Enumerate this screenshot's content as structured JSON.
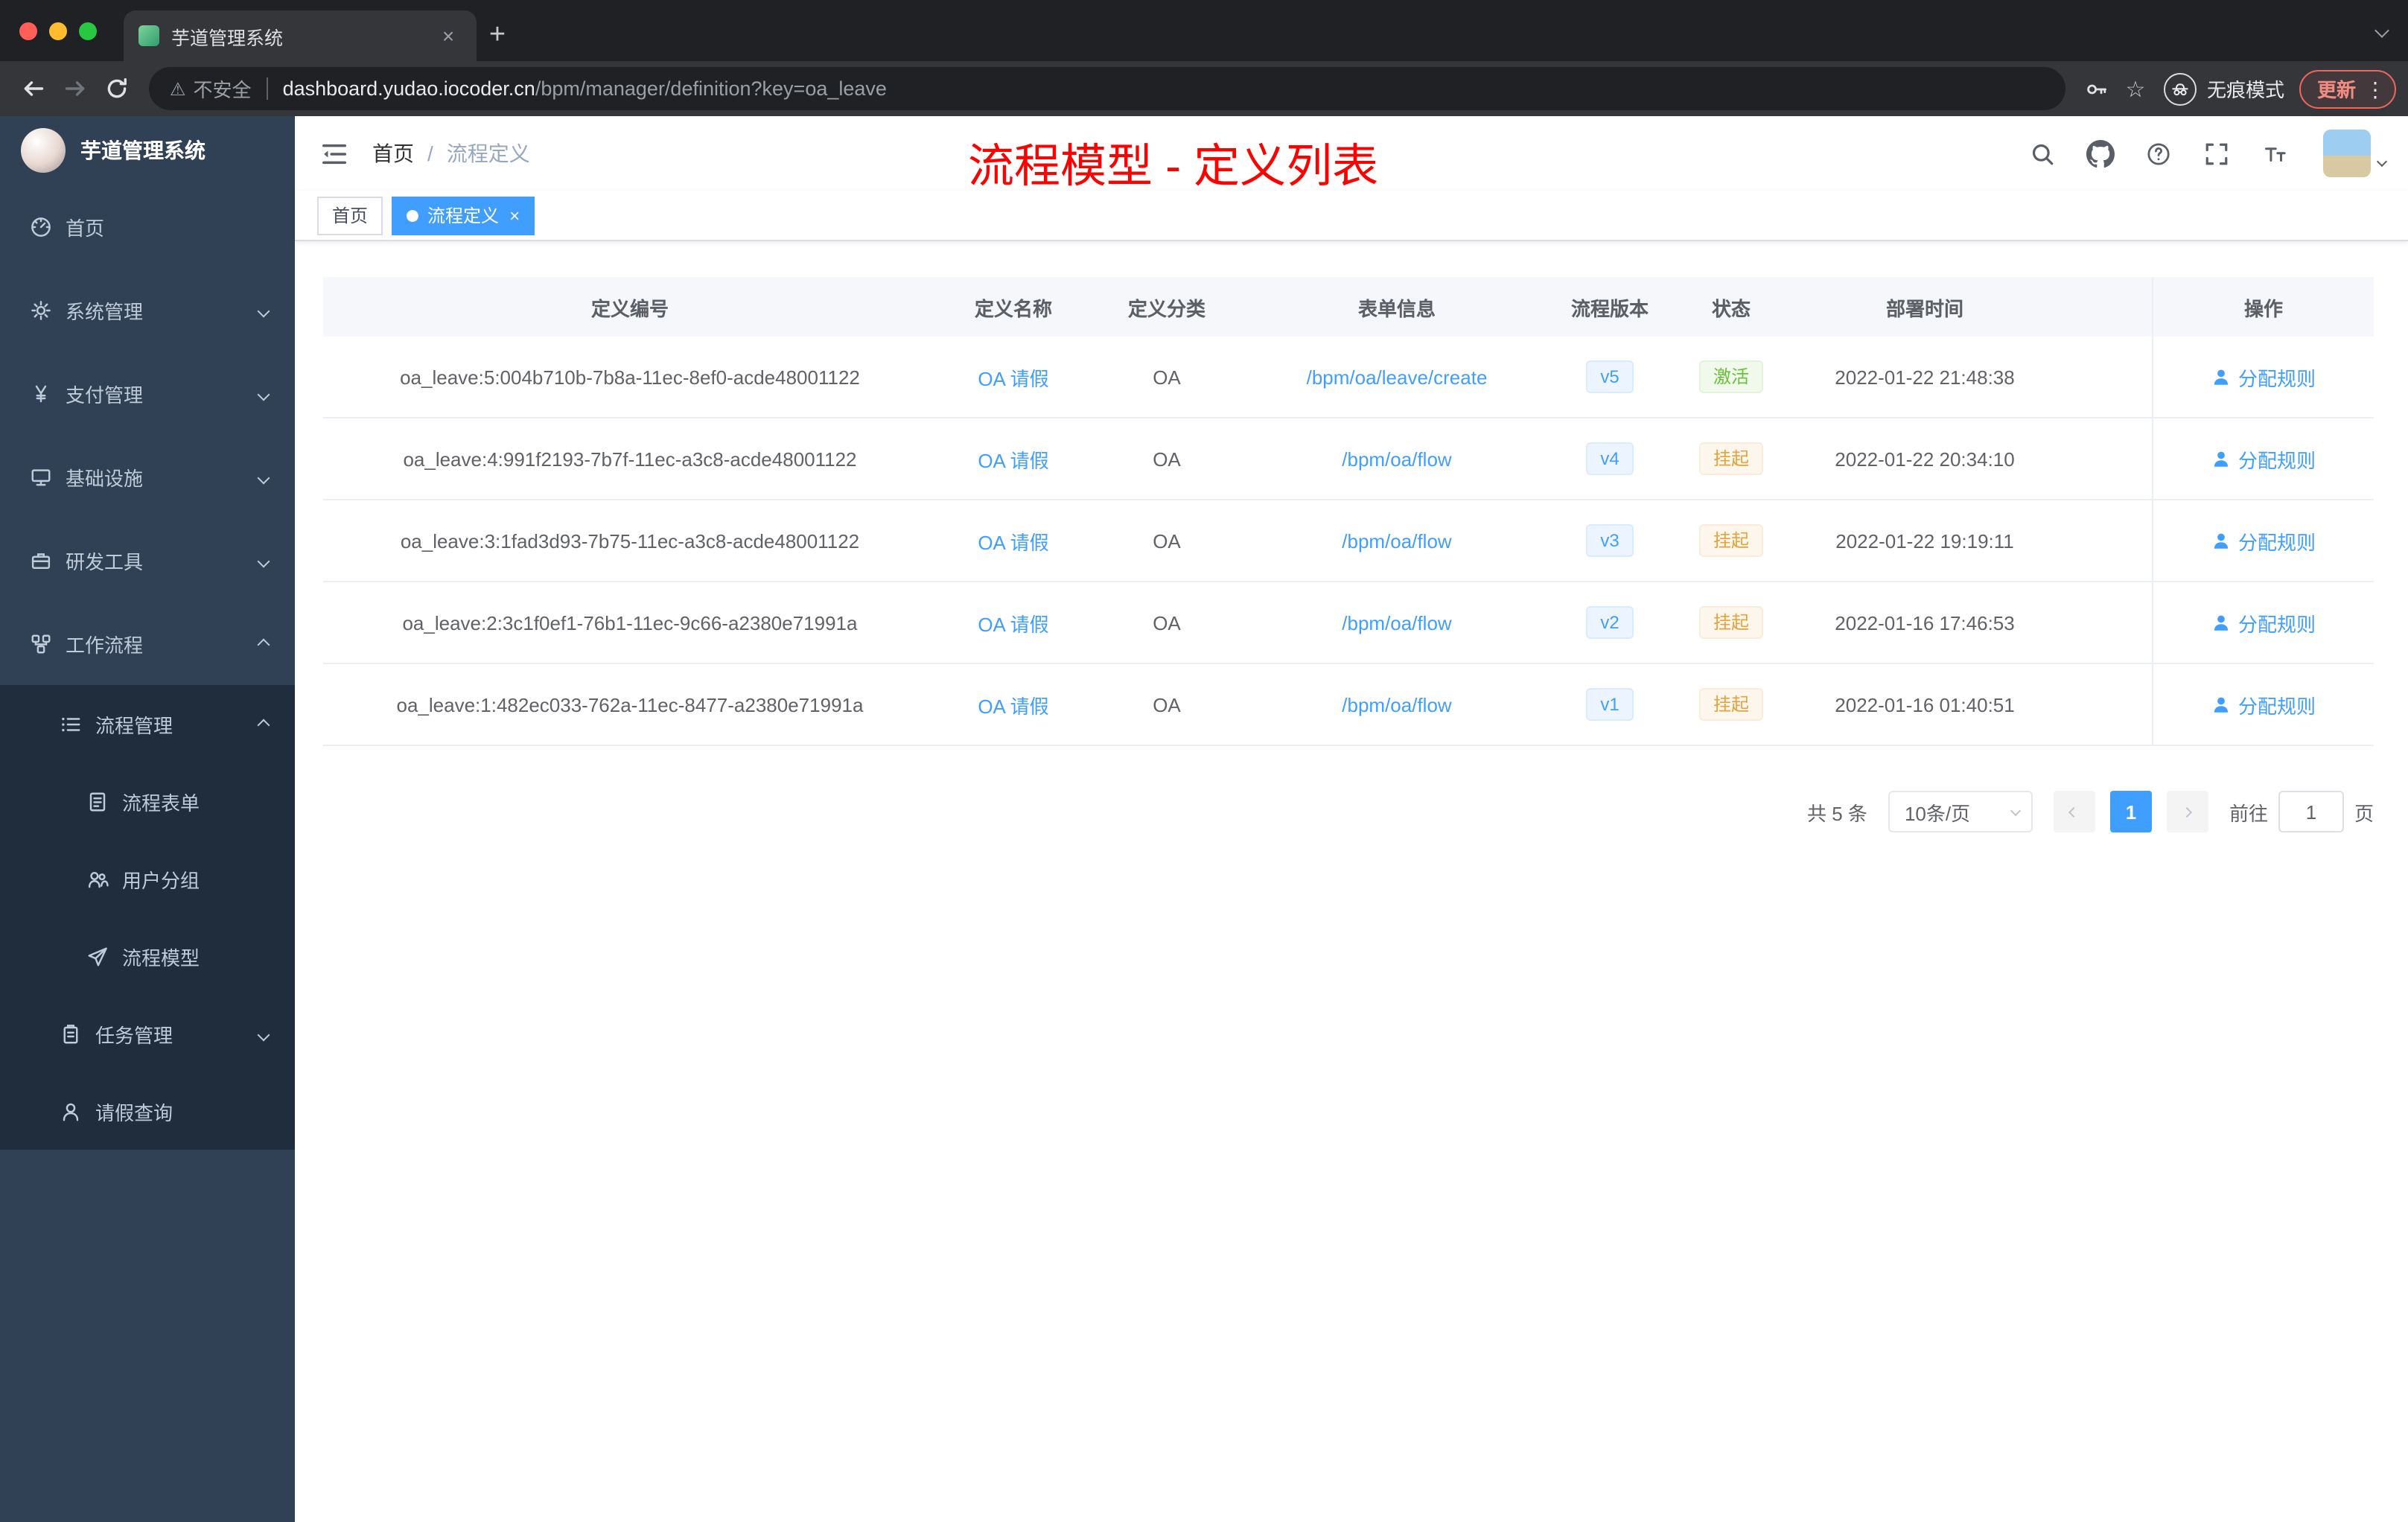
{
  "glyphs": {
    "close": "×",
    "plus": "+",
    "star": "☆",
    "warning": "⚠",
    "kebab": "⋮"
  },
  "browser": {
    "tab_title": "芋道管理系统",
    "security_label": "不安全",
    "url_host": "dashboard.yudao.iocoder.cn",
    "url_path": "/bpm/manager/definition?key=oa_leave",
    "incognito_label": "无痕模式",
    "update_label": "更新"
  },
  "sidebar": {
    "app_title": "芋道管理系统",
    "items": [
      {
        "label": "首页",
        "icon": "dashboard-icon"
      },
      {
        "label": "系统管理",
        "icon": "gear-icon"
      },
      {
        "label": "支付管理",
        "icon": "yen-icon"
      },
      {
        "label": "基础设施",
        "icon": "monitor-icon"
      },
      {
        "label": "研发工具",
        "icon": "briefcase-icon"
      },
      {
        "label": "工作流程",
        "icon": "workflow-icon"
      },
      {
        "label": "流程管理",
        "icon": "list-icon"
      },
      {
        "label": "流程表单",
        "icon": "form-icon"
      },
      {
        "label": "用户分组",
        "icon": "users-icon"
      },
      {
        "label": "流程模型",
        "icon": "send-icon"
      },
      {
        "label": "任务管理",
        "icon": "clipboard-icon"
      },
      {
        "label": "请假查询",
        "icon": "user-icon"
      }
    ]
  },
  "navbar": {
    "breadcrumb_home": "首页",
    "breadcrumb_separator": "/",
    "breadcrumb_current": "流程定义",
    "annotation": "流程模型 - 定义列表"
  },
  "tags": [
    {
      "label": "首页",
      "active": false
    },
    {
      "label": "流程定义",
      "active": true
    }
  ],
  "table": {
    "columns": [
      "定义编号",
      "定义名称",
      "定义分类",
      "表单信息",
      "流程版本",
      "状态",
      "部署时间",
      "操作"
    ],
    "rows": [
      {
        "id": "oa_leave:5:004b710b-7b8a-11ec-8ef0-acde48001122",
        "name": "OA 请假",
        "category": "OA",
        "form": "/bpm/oa/leave/create",
        "version": "v5",
        "status": "激活",
        "status_type": "success",
        "time": "2022-01-22 21:48:38",
        "action": "分配规则"
      },
      {
        "id": "oa_leave:4:991f2193-7b7f-11ec-a3c8-acde48001122",
        "name": "OA 请假",
        "category": "OA",
        "form": "/bpm/oa/flow",
        "version": "v4",
        "status": "挂起",
        "status_type": "warning",
        "time": "2022-01-22 20:34:10",
        "action": "分配规则"
      },
      {
        "id": "oa_leave:3:1fad3d93-7b75-11ec-a3c8-acde48001122",
        "name": "OA 请假",
        "category": "OA",
        "form": "/bpm/oa/flow",
        "version": "v3",
        "status": "挂起",
        "status_type": "warning",
        "time": "2022-01-22 19:19:11",
        "action": "分配规则"
      },
      {
        "id": "oa_leave:2:3c1f0ef1-76b1-11ec-9c66-a2380e71991a",
        "name": "OA 请假",
        "category": "OA",
        "form": "/bpm/oa/flow",
        "version": "v2",
        "status": "挂起",
        "status_type": "warning",
        "time": "2022-01-16 17:46:53",
        "action": "分配规则"
      },
      {
        "id": "oa_leave:1:482ec033-762a-11ec-8477-a2380e71991a",
        "name": "OA 请假",
        "category": "OA",
        "form": "/bpm/oa/flow",
        "version": "v1",
        "status": "挂起",
        "status_type": "warning",
        "time": "2022-01-16 01:40:51",
        "action": "分配规则"
      }
    ]
  },
  "pagination": {
    "total": "共 5 条",
    "page_size": "10条/页",
    "current_page": "1",
    "goto_label": "前往",
    "goto_value": "1",
    "page_unit": "页"
  },
  "colors": {
    "accent": "#409eff",
    "success": "#67c23a",
    "warning": "#e6a23c",
    "annotation_red": "#fd0000",
    "sidebar_bg": "#304156",
    "submenu_bg": "#1f2d3d"
  }
}
